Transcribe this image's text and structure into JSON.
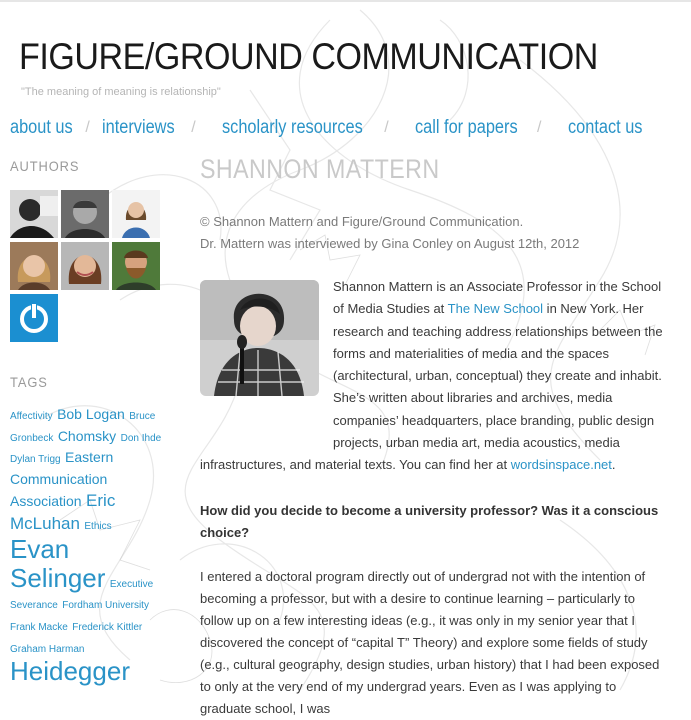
{
  "site": {
    "title": "FIGURE/GROUND COMMUNICATION",
    "tagline": "\"The meaning of meaning is relationship\""
  },
  "nav": {
    "items": [
      {
        "label": "about us"
      },
      {
        "label": "interviews"
      },
      {
        "label": "scholarly resources"
      },
      {
        "label": "call for papers"
      },
      {
        "label": "contact us"
      }
    ],
    "separator": "/"
  },
  "sidebar": {
    "authors_heading": "AUTHORS",
    "tags_heading": "TAGS",
    "tags": [
      {
        "label": "Affectivity",
        "size": "s"
      },
      {
        "label": "Bob Logan",
        "size": "m"
      },
      {
        "label": "Bruce Gronbeck",
        "size": "s"
      },
      {
        "label": "Chomsky",
        "size": "m"
      },
      {
        "label": "Don Ihde",
        "size": "s"
      },
      {
        "label": "Dylan Trigg",
        "size": "s"
      },
      {
        "label": "Eastern Communication Association",
        "size": "m"
      },
      {
        "label": "Eric McLuhan",
        "size": "l"
      },
      {
        "label": "Ethics",
        "size": "s"
      },
      {
        "label": "Evan Selinger",
        "size": "xl"
      },
      {
        "label": "Executive Severance",
        "size": "s"
      },
      {
        "label": "Fordham University",
        "size": "s"
      },
      {
        "label": "Frank Macke",
        "size": "s"
      },
      {
        "label": "Frederick Kittler",
        "size": "s"
      },
      {
        "label": "Graham Harman",
        "size": "s"
      },
      {
        "label": "Heidegger",
        "size": "xl"
      }
    ]
  },
  "post": {
    "title": "SHANNON MATTERN",
    "copyright": "© Shannon Mattern and Figure/Ground Communication.",
    "interview_note": "Dr. Mattern was interviewed by Gina Conley on August 12th, 2012",
    "bio_1": "Shannon Mattern is an Associate Professor in the School of Media Studies at ",
    "bio_link_1": "The New School",
    "bio_2": " in New York. Her research and teaching address relationships between the forms and materialities of media and the spaces (architectural, urban, conceptual) they create and inhabit. She’s written about libraries and archives, media companies’ headquarters, place branding, public design projects, urban media art, media acoustics, media infrastructures, and material texts. You can find her at ",
    "bio_link_2": "wordsinspace.net",
    "bio_3": ".",
    "question": "How did you decide to become a university professor? Was it a conscious choice?",
    "answer": "I entered a doctoral program directly out of undergrad not with the intention of becoming a professor, but with a desire to continue learning – particularly to follow up on a few interesting ideas (e.g., it was only in my senior year that I discovered the concept of “capital T” Theory) and explore some fields of study (e.g., cultural geography, design studies, urban history) that I had been exposed to only at the very end of my undergrad years. Even as I was applying to graduate school, I was"
  },
  "colors": {
    "link": "#2a93c7",
    "title": "#1a1a1a",
    "post_title": "#c9c9c9",
    "muted": "#9a9a9a"
  },
  "icons": {
    "author_badge": "power-icon"
  }
}
